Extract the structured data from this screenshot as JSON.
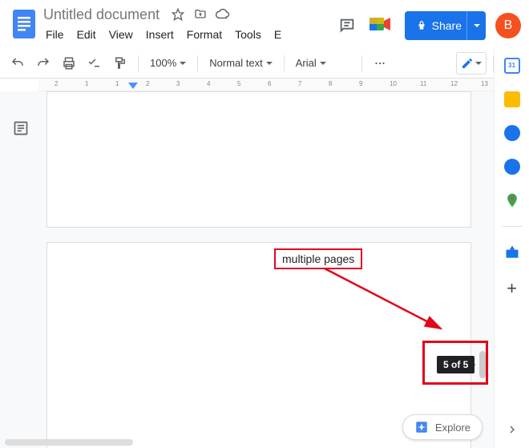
{
  "header": {
    "title": "Untitled document",
    "avatar_letter": "B",
    "share_label": "Share"
  },
  "menus": [
    "File",
    "Edit",
    "View",
    "Insert",
    "Format",
    "Tools",
    "E"
  ],
  "toolbar": {
    "zoom": "100%",
    "style": "Normal text",
    "font": "Arial"
  },
  "ruler_numbers": [
    "2",
    "1",
    "1",
    "2",
    "3",
    "4",
    "5",
    "6",
    "7",
    "8",
    "9",
    "10",
    "11",
    "12",
    "13"
  ],
  "page_indicator": "5 of 5",
  "explore_label": "Explore",
  "annotation_label": "multiple pages",
  "sidepanel_apps": [
    {
      "name": "calendar",
      "color": "#4285f4"
    },
    {
      "name": "keep",
      "color": "#fbbc04"
    },
    {
      "name": "tasks",
      "color": "#1a73e8"
    },
    {
      "name": "contacts",
      "color": "#1a73e8"
    },
    {
      "name": "maps",
      "color": "#34a853"
    }
  ]
}
